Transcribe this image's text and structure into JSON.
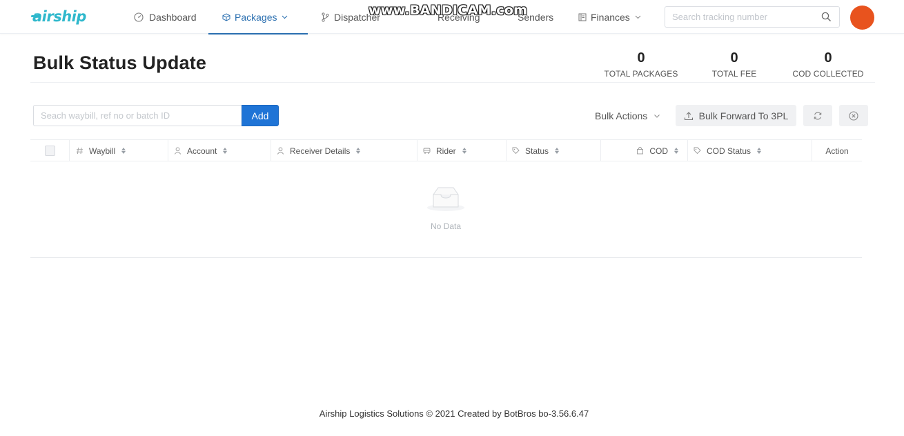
{
  "brand": {
    "name": "airship",
    "color": "#2fb8cc"
  },
  "nav": {
    "dashboard": "Dashboard",
    "packages": "Packages",
    "dispatcher": "Dispatcher",
    "receiving": "Receiving",
    "senders": "Senders",
    "finances": "Finances"
  },
  "watermark": "www.BANDICAM.com",
  "tracking_search": {
    "placeholder": "Search tracking number"
  },
  "avatar": {
    "color": "#e8531e"
  },
  "page": {
    "title": "Bulk Status Update"
  },
  "stats": [
    {
      "value": "0",
      "label": "TOTAL PACKAGES"
    },
    {
      "value": "0",
      "label": "TOTAL FEE"
    },
    {
      "value": "0",
      "label": "COD COLLECTED"
    }
  ],
  "toolbar": {
    "waybill_placeholder": "Seach waybill, ref no or batch ID",
    "add_label": "Add",
    "bulk_actions_label": "Bulk Actions",
    "bulk_forward_label": "Bulk Forward To 3PL"
  },
  "table": {
    "columns": {
      "waybill": "Waybill",
      "account": "Account",
      "receiver": "Receiver Details",
      "rider": "Rider",
      "status": "Status",
      "cod": "COD",
      "cod_status": "COD Status",
      "action": "Action"
    },
    "empty_text": "No Data"
  },
  "footer": {
    "text": "Airship Logistics Solutions © 2021 Created by BotBros bo-3.56.6.47"
  },
  "colors": {
    "primary": "#1f74d6",
    "nav_active": "#2a6fb0"
  }
}
